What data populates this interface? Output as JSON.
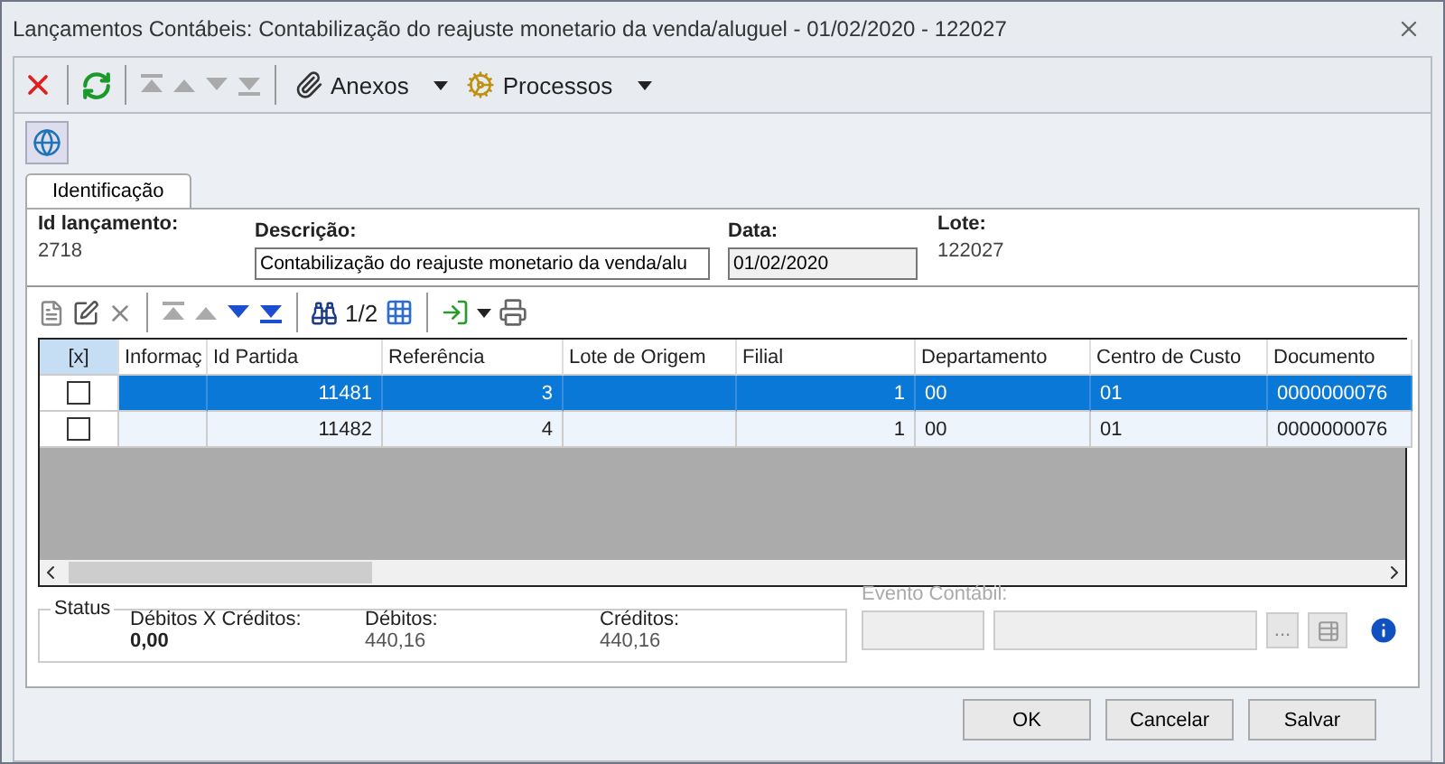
{
  "window": {
    "title": "Lançamentos Contábeis: Contabilização do reajuste monetario da venda/aluguel - 01/02/2020 - 122027"
  },
  "toolbar": {
    "nav": [
      {
        "disabled": true
      },
      {
        "disabled": true
      },
      {
        "disabled": true
      },
      {
        "disabled": true
      }
    ],
    "menus": [
      {
        "label": "Anexos"
      },
      {
        "label": "Processos"
      }
    ]
  },
  "tabs": [
    {
      "label": "Identificação",
      "selected": true
    }
  ],
  "fields": {
    "id": {
      "label": "Id lançamento:",
      "value": "2718"
    },
    "descricao": {
      "label": "Descrição:",
      "value": "Contabilização do reajuste monetario da venda/alu"
    },
    "data": {
      "label": "Data:",
      "value": "01/02/2020"
    },
    "lote": {
      "label": "Lote:",
      "value": "122027"
    }
  },
  "grid_toolbar": {
    "nav": [
      {
        "disabled": true
      },
      {
        "disabled": true
      },
      {
        "disabled": false
      },
      {
        "disabled": false
      }
    ],
    "page": "1/2"
  },
  "table": {
    "columns": [
      "[x]",
      "Informaç",
      "Id Partida",
      "Referência",
      "Lote de Origem",
      "Filial",
      "Departamento",
      "Centro de Custo",
      "Documento"
    ],
    "rows": [
      {
        "selected": true,
        "checked": false,
        "cells": [
          "",
          "",
          "11481",
          "3",
          "",
          "1",
          "00",
          "01",
          "0000000076"
        ]
      },
      {
        "selected": false,
        "checked": false,
        "cells": [
          "",
          "",
          "11482",
          "4",
          "",
          "1",
          "00",
          "01",
          "0000000076"
        ]
      }
    ]
  },
  "status": {
    "title": "Status",
    "items": [
      {
        "label": "Débitos X Créditos:",
        "value": "0,00",
        "bold": true
      },
      {
        "label": "Débitos:",
        "value": "440,16",
        "bold": false
      },
      {
        "label": "Créditos:",
        "value": "440,16",
        "bold": false
      }
    ]
  },
  "evento": {
    "label": "Evento Contábil:",
    "disabled": true,
    "button": "..."
  },
  "buttons": [
    "OK",
    "Cancelar",
    "Salvar"
  ]
}
